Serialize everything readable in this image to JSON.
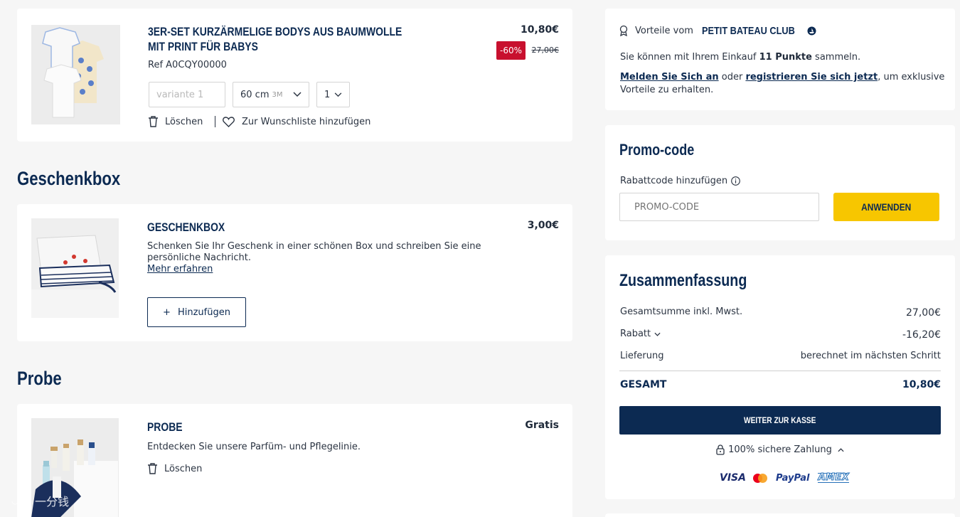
{
  "product": {
    "title_line1": "3er-Set kurzärmelige Bodys aus Baumwolle",
    "title_line2": "mit Print für Babys",
    "ref": "Ref A0CQY00000",
    "variant_placeholder": "variante 1",
    "size_value": "60 cm",
    "size_tag": "3M",
    "quantity": "1",
    "price": "10,80€",
    "discount_badge": "-60%",
    "old_price": "27,00€",
    "delete_label": "Löschen",
    "wishlist_label": "Zur Wunschliste hinzufügen"
  },
  "giftbox": {
    "section_heading": "Geschenkbox",
    "title": "Geschenkbox",
    "price": "3,00€",
    "description_line1": "Schenken Sie Ihr Geschenk in einer schönen Box und schreiben Sie eine",
    "description_line2": "persönliche Nachricht.",
    "more_link": "Mehr erfahren",
    "add_button": "Hinzufügen"
  },
  "sample": {
    "section_heading": "Probe",
    "title": "Probe",
    "price": "Gratis",
    "description": "Entdecken Sie unsere Parfüm- und Pflegelinie.",
    "delete_label": "Löschen"
  },
  "club": {
    "prefix": "Vorteile vom",
    "brand": "PETIT BATEAU CLUB",
    "points_pre": "Sie können mit Ihrem Einkauf ",
    "points_bold": "11 Punkte",
    "points_post": " sammeln.",
    "login_link": "Melden Sie Sich an",
    "or_text": " oder ",
    "register_link": "registrieren Sie sich jetzt",
    "benefits_line1_post": ", um exklusive",
    "benefits_line2": "Vorteile zu erhalten."
  },
  "promo": {
    "heading": "Promo-code",
    "label": "Rabattcode hinzufügen",
    "placeholder": "PROMO-CODE",
    "apply_button": "Anwenden"
  },
  "summary": {
    "heading": "Zusammenfassung",
    "rows": [
      {
        "label": "Gesamtsumme inkl. Mwst.",
        "value": "27,00€"
      },
      {
        "label": "Rabatt",
        "value": "-16,20€"
      },
      {
        "label": "Lieferung",
        "value": "berechnet im nächsten Schritt"
      }
    ],
    "total_label": "GESAMT",
    "total_value": "10,80€",
    "checkout_button": "Weiter zur Kasse",
    "secure_label": "100% sichere Zahlung",
    "payment_methods": [
      "VISA",
      "Mastercard",
      "PayPal",
      "AMEX"
    ]
  },
  "watermark": "一分钱",
  "colors": {
    "navy": "#0c2a52",
    "yellow": "#f7c600",
    "discount_red": "#c8102e",
    "background": "#f6f6f6"
  }
}
